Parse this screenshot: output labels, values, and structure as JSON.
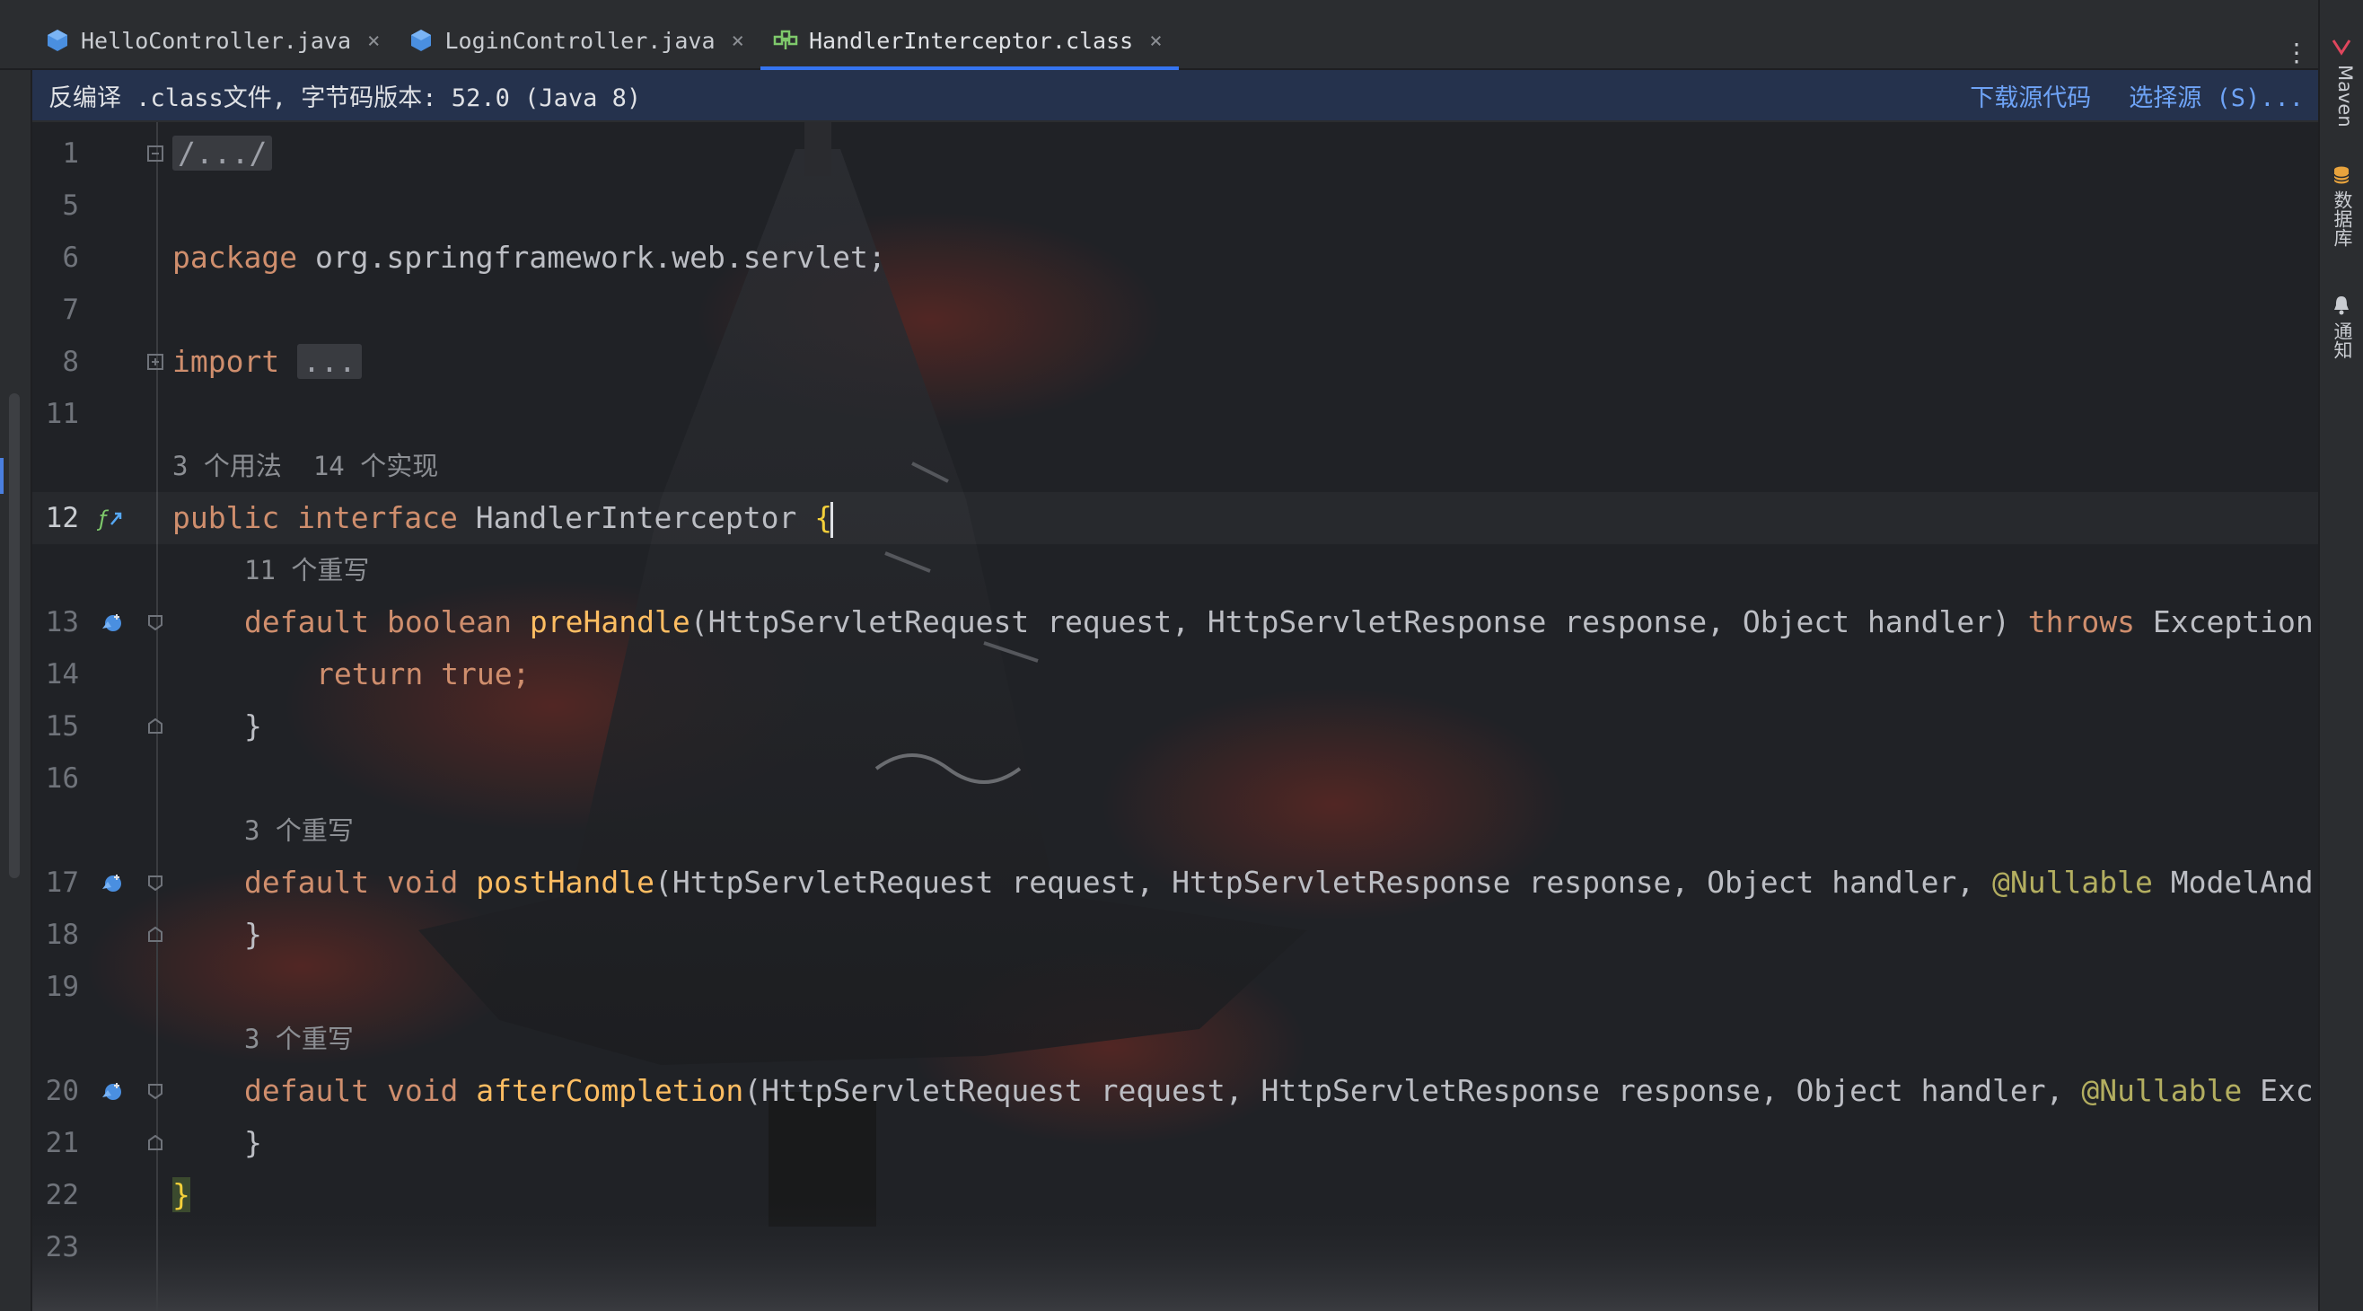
{
  "tabs": [
    {
      "label": "HelloController.java",
      "icon": "java-interface-icon",
      "active": false
    },
    {
      "label": "LoginController.java",
      "icon": "java-interface-icon",
      "active": false
    },
    {
      "label": "HandlerInterceptor.class",
      "icon": "class-file-icon",
      "active": true
    }
  ],
  "tab_close": "×",
  "tab_more": "⋮",
  "banner": {
    "message": "反编译 .class文件, 字节码版本: 52.0 (Java 8)",
    "download_link": "下载源代码",
    "choose_link": "选择源 (S)..."
  },
  "right_tools": {
    "maven": "Maven",
    "database": "数据库",
    "notifications": "通知"
  },
  "editor": {
    "lines": {
      "l1": "1",
      "l5": "5",
      "l6": "6",
      "l7": "7",
      "l8": "8",
      "l11": "11",
      "l12": "12",
      "l13": "13",
      "l14": "14",
      "l15": "15",
      "l16": "16",
      "l17": "17",
      "l18": "18",
      "l19": "19",
      "l20": "20",
      "l21": "21",
      "l22": "22",
      "l23": "23"
    },
    "header_comment": "/.../",
    "package_kw": "package",
    "package_name": " org.springframework.web.servlet;",
    "import_kw": "import",
    "import_fold": "...",
    "hint_interface": "3 个用法  14 个实现",
    "iface_public": "public",
    "iface_interface": " interface",
    "iface_name": " HandlerInterceptor ",
    "brace_open": "{",
    "brace_close": "}",
    "hint_pre": "11 个重写",
    "pre_default": "default",
    "pre_boolean": " boolean",
    "pre_name": " preHandle",
    "pre_params": "(HttpServletRequest request, HttpServletResponse response, Object handler) ",
    "pre_throws": "throws",
    "pre_exc": " Exception",
    "ret_kw": "return",
    "ret_true": " true;",
    "hint_post": "3 个重写",
    "post_default": "default",
    "post_void": " void",
    "post_name": " postHandle",
    "post_params": "(HttpServletRequest request, HttpServletResponse response, Object handler, ",
    "post_ann": "@Nullable",
    "post_rest": " ModelAnd",
    "hint_after": "3 个重写",
    "after_default": "default",
    "after_void": " void",
    "after_name": " afterCompletion",
    "after_params": "(HttpServletRequest request, HttpServletResponse response, Object handler, ",
    "after_ann": "@Nullable",
    "after_rest": " Exc",
    "close_method": "}"
  },
  "colors": {
    "keyword": "#cf8e6d",
    "method": "#56a8f5",
    "method_decl": "#fdbd62",
    "annotation": "#b3ae60",
    "accent": "#3574f0",
    "banner_bg": "#25324d",
    "link": "#6ea3f6"
  }
}
